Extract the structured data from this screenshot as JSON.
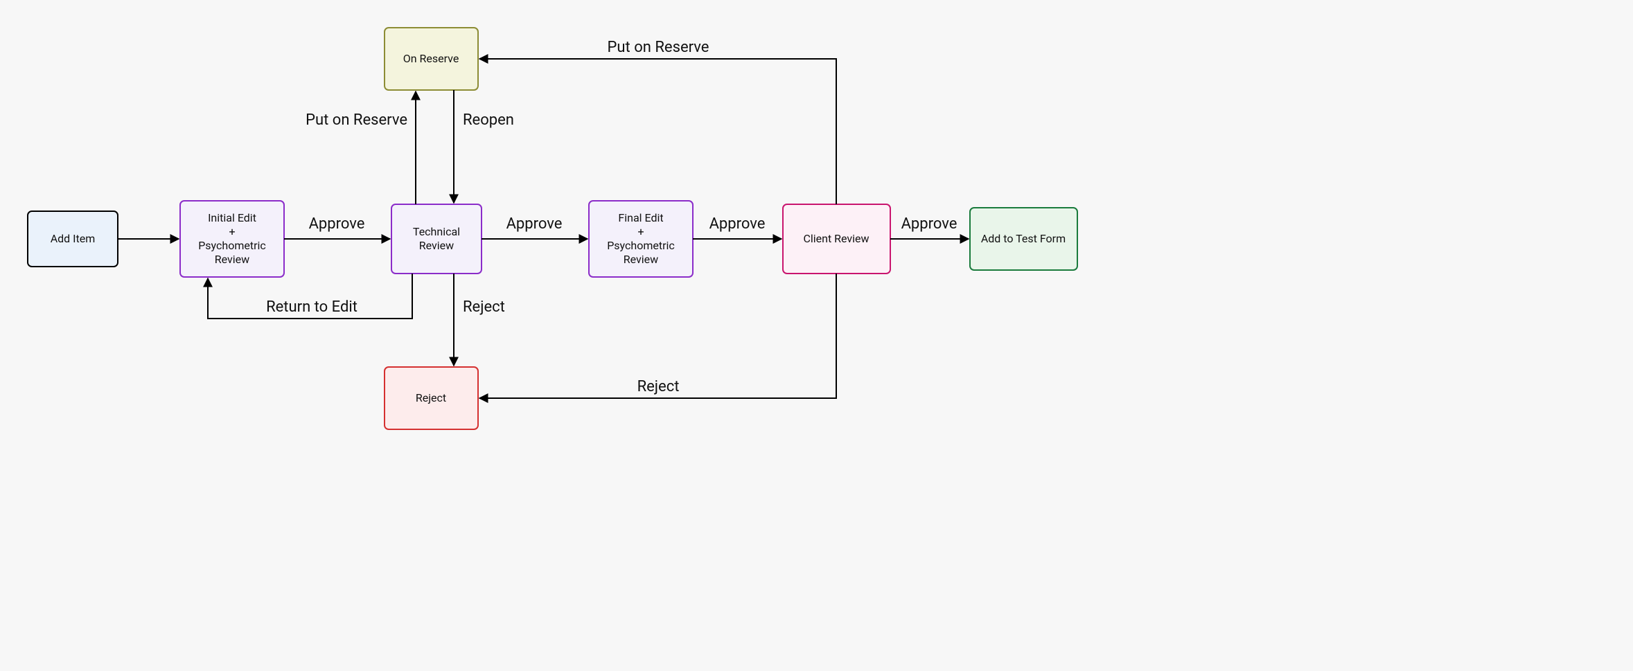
{
  "nodes": {
    "add_item": {
      "label": "Add Item",
      "fill": "#eaf2fb",
      "stroke": "#000000"
    },
    "initial_edit": {
      "label": "Initial Edit\n+\nPsychometric\nReview",
      "fill": "#f4f1fb",
      "stroke": "#8b2cc9"
    },
    "technical_review": {
      "label": "Technical\nReview",
      "fill": "#f4f1fb",
      "stroke": "#8b2cc9"
    },
    "final_edit": {
      "label": "Final Edit\n+\nPsychometric\nReview",
      "fill": "#f4f1fb",
      "stroke": "#8b2cc9"
    },
    "client_review": {
      "label": "Client Review",
      "fill": "#fdf1f7",
      "stroke": "#c9156e"
    },
    "add_to_test": {
      "label": "Add to Test Form",
      "fill": "#e9f5ea",
      "stroke": "#1a7b3c"
    },
    "on_reserve": {
      "label": "On Reserve",
      "fill": "#f4f4dd",
      "stroke": "#8c8c34"
    },
    "reject": {
      "label": "Reject",
      "fill": "#fdecec",
      "stroke": "#d53030"
    }
  },
  "edges": {
    "add_to_initial": {
      "label": ""
    },
    "initial_to_tech": {
      "label": "Approve"
    },
    "tech_to_final": {
      "label": "Approve"
    },
    "final_to_client": {
      "label": "Approve"
    },
    "client_to_testform": {
      "label": "Approve"
    },
    "tech_to_reserve": {
      "label": "Put on Reserve"
    },
    "reserve_to_tech": {
      "label": "Reopen"
    },
    "tech_to_initial": {
      "label": "Return to Edit"
    },
    "tech_to_reject": {
      "label": "Reject"
    },
    "client_to_reject": {
      "label": "Reject"
    },
    "client_to_reserve": {
      "label": "Put on Reserve"
    }
  }
}
